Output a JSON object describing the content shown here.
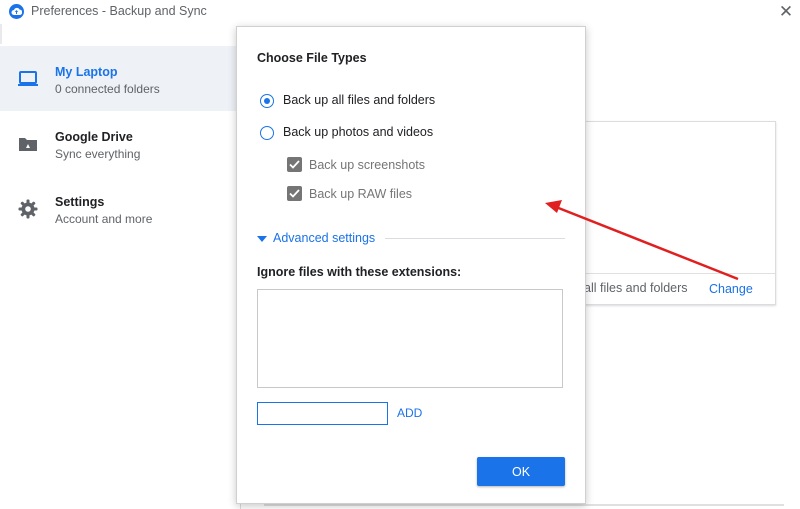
{
  "window": {
    "title": "Preferences - Backup and Sync",
    "close_glyph": "✕"
  },
  "sidebar": {
    "items": [
      {
        "title": "My Laptop",
        "subtitle": "0 connected folders",
        "icon": "laptop-icon",
        "active": true
      },
      {
        "title": "Google Drive",
        "subtitle": "Sync everything",
        "icon": "drive-folder-icon",
        "active": false
      },
      {
        "title": "Settings",
        "subtitle": "Account and more",
        "icon": "gear-icon",
        "active": false
      }
    ]
  },
  "background_card": {
    "text": "all files and folders",
    "link": "Change"
  },
  "dialog": {
    "title": "Choose File Types",
    "options": [
      {
        "label": "Back up all files and folders",
        "checked": true
      },
      {
        "label": "Back up photos and videos",
        "checked": false
      }
    ],
    "suboptions": [
      {
        "label": "Back up screenshots",
        "checked": true
      },
      {
        "label": "Back up RAW files",
        "checked": true
      }
    ],
    "advanced_label": "Advanced settings",
    "ignore_label": "Ignore files with these extensions:",
    "extension_input_value": "",
    "add_label": "ADD",
    "ok_label": "OK"
  },
  "colors": {
    "accent": "#1a73e8",
    "annotation_arrow": "#e02020"
  }
}
